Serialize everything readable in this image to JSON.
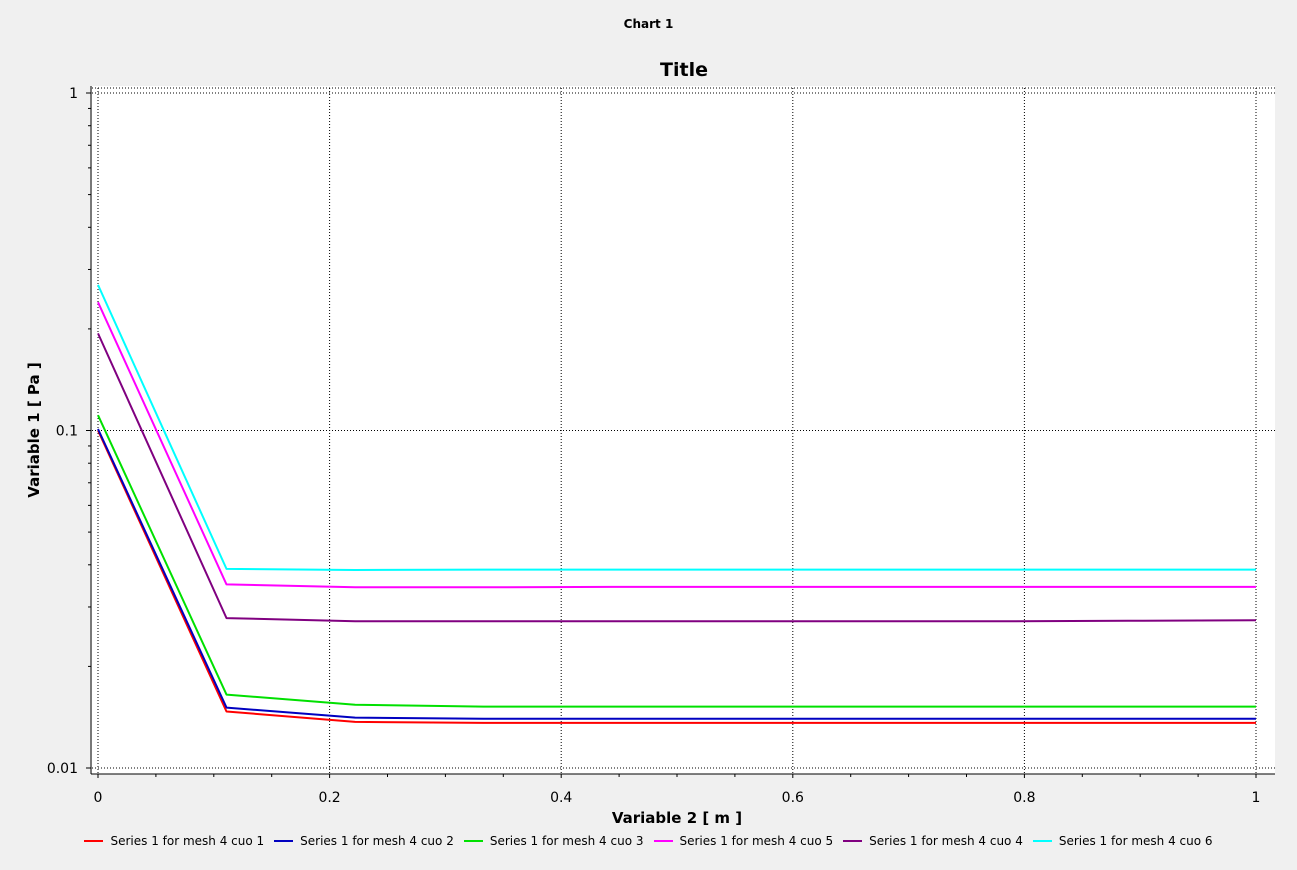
{
  "window": {
    "title": "Chart 1"
  },
  "chart_data": {
    "type": "line",
    "title": "Title",
    "xlabel": "Variable 2 [ m ]",
    "ylabel": "Variable 1 [ Pa ]",
    "xlim": [
      0,
      1
    ],
    "ylim": [
      0.01,
      1
    ],
    "yscale": "log",
    "grid": true,
    "legend_position": "bottom",
    "x_ticks": [
      "0",
      "0.2",
      "0.4",
      "0.6",
      "0.8",
      "1"
    ],
    "y_ticks": [
      "1",
      "0.1",
      "0.01"
    ],
    "x": [
      0,
      0.111,
      0.222,
      0.333,
      0.444,
      0.556,
      0.667,
      0.778,
      0.889,
      1
    ],
    "series": [
      {
        "name": "Series 1 for mesh 4 cuo 1",
        "color": "#ff0000",
        "values": [
          0.1,
          0.0147,
          0.0137,
          0.0136,
          0.0136,
          0.0136,
          0.0136,
          0.0136,
          0.0136,
          0.0136
        ]
      },
      {
        "name": "Series 1 for mesh 4 cuo 2",
        "color": "#0000c0",
        "values": [
          0.101,
          0.0151,
          0.0141,
          0.014,
          0.014,
          0.014,
          0.014,
          0.014,
          0.014,
          0.014
        ]
      },
      {
        "name": "Series 1 for mesh 4 cuo 3",
        "color": "#00e000",
        "values": [
          0.111,
          0.0165,
          0.0154,
          0.0152,
          0.0152,
          0.0152,
          0.0152,
          0.0152,
          0.0152,
          0.0152
        ]
      },
      {
        "name": "Series 1 for mesh 4 cuo 5",
        "color": "#ff00ff",
        "values": [
          0.24,
          0.035,
          0.0343,
          0.0343,
          0.0344,
          0.0344,
          0.0344,
          0.0344,
          0.0344,
          0.0344
        ]
      },
      {
        "name": "Series 1 for mesh 4 cuo 4",
        "color": "#800080",
        "values": [
          0.194,
          0.0278,
          0.0272,
          0.0272,
          0.0272,
          0.0272,
          0.0272,
          0.0272,
          0.0273,
          0.0274
        ]
      },
      {
        "name": "Series 1 for mesh 4 cuo 6",
        "color": "#00ffff",
        "values": [
          0.27,
          0.0389,
          0.0386,
          0.0387,
          0.0387,
          0.0387,
          0.0387,
          0.0387,
          0.0387,
          0.0387
        ]
      }
    ]
  }
}
